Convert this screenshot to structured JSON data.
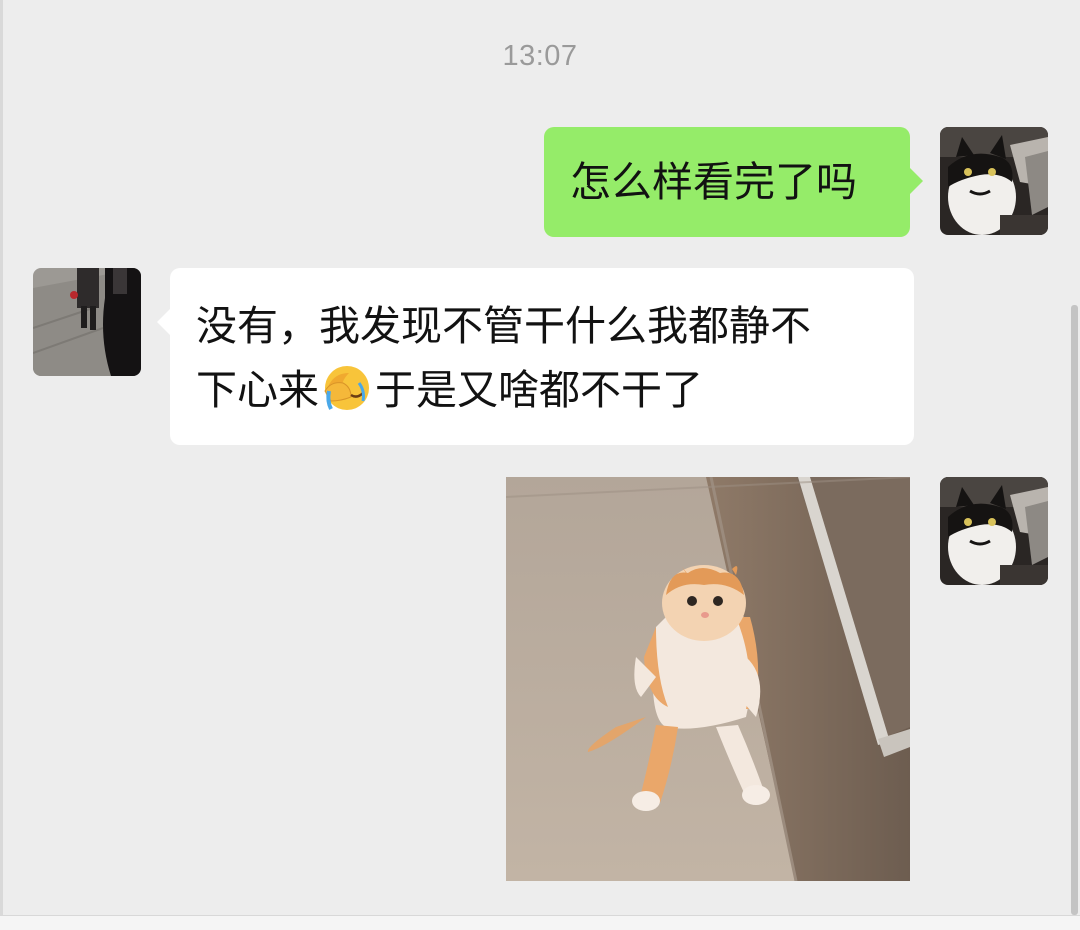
{
  "chat": {
    "timestamp": "13:07",
    "messages": [
      {
        "sender": "self",
        "type": "text",
        "lines": [
          "怎么样看完了吗"
        ]
      },
      {
        "sender": "other",
        "type": "text",
        "lines": [
          "没有，我发现不管干什么我都静不",
          "下心来",
          "于是又啥都不干了"
        ],
        "emoji": "face-with-hand-over-eyes-crying-emoji"
      },
      {
        "sender": "self",
        "type": "image",
        "image": "orange-white-cat-sitting-photo"
      }
    ]
  },
  "colors": {
    "background": "#ededed",
    "sent_bubble": "#95ec69",
    "received_bubble": "#ffffff",
    "timestamp_text": "#9a9a9a",
    "message_text": "#121212"
  }
}
